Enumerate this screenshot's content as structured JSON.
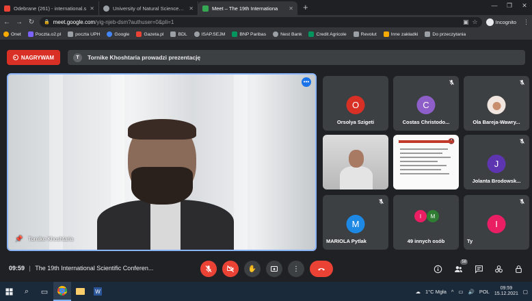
{
  "browser": {
    "tabs": [
      {
        "title": "Odebrane (261) - international.s",
        "icon": "gmail-icon",
        "color": "#ea4335"
      },
      {
        "title": "University of Natural Sciences an",
        "icon": "globe-icon",
        "color": "#9aa0a6"
      },
      {
        "title": "Meet – The 19th Internationa",
        "icon": "meet-icon",
        "color": "#34a853"
      }
    ],
    "url_host": "meet.google.com",
    "url_path": "/yig-njeb-dsm?authuser=0&pli=1",
    "profile_label": "Incognito",
    "bookmarks": [
      {
        "label": "Onet",
        "color": "#f9ab00"
      },
      {
        "label": "Poczta.o2.pl",
        "color": "#7b61ff"
      },
      {
        "label": "poczta UPH",
        "color": "#9aa0a6"
      },
      {
        "label": "Google",
        "color": "#4285f4"
      },
      {
        "label": "Gazeta.pl",
        "color": "#ea4335"
      },
      {
        "label": "BDL",
        "color": "#9aa0a6"
      },
      {
        "label": "ISAP.SEJM",
        "color": "#9aa0a6"
      },
      {
        "label": "BNP Paribas",
        "color": "#00965e"
      },
      {
        "label": "Nest Bank",
        "color": "#9aa0a6"
      },
      {
        "label": "Credit Agricole",
        "color": "#00965e"
      },
      {
        "label": "Revolut",
        "color": "#9aa0a6"
      },
      {
        "label": "Inne zakładki",
        "color": "#f9ab00"
      },
      {
        "label": "Do przeczytania",
        "color": "#9aa0a6"
      }
    ]
  },
  "meet": {
    "recording_label": "NAGRYWAM",
    "presenter_initial": "T",
    "presenter_banner": "Tornike Khoshtaria prowadzi prezentację",
    "main_speaker": "Tornike Khoshtaria",
    "participants": [
      {
        "name": "Orsolya Szigeti",
        "initial": "O",
        "color": "#d93025",
        "muted": false
      },
      {
        "name": "Costas Christodo...",
        "initial": "C",
        "color": "#8e5fc9",
        "muted": true
      },
      {
        "name": "Ola Bareja-Wawry...",
        "initial": "",
        "color": "#f1e6df",
        "muted": true
      },
      {
        "name": "Jolanta Brodowsk...",
        "initial": "J",
        "color": "#5e35b1",
        "muted": true
      },
      {
        "name": "MARIOLA Pytlak",
        "initial": "M",
        "color": "#1e88e5",
        "muted": true
      },
      {
        "name": "Ty",
        "initial": "I",
        "color": "#e91e63",
        "muted": true
      }
    ],
    "others_label": "49 innych osób",
    "others_initials": [
      "I",
      "M"
    ],
    "others_colors": [
      "#e91e63",
      "#2e7d32"
    ],
    "time": "09:59",
    "meeting_title": "The 19th International Scientific Conferen...",
    "people_count": "58"
  },
  "taskbar": {
    "weather": "1°C Mgła",
    "lang": "POL",
    "time": "09:59",
    "date": "15.12.2021"
  },
  "colors": {
    "accent": "#8ab4f8",
    "danger": "#ea4335",
    "tile": "#3c4043"
  }
}
